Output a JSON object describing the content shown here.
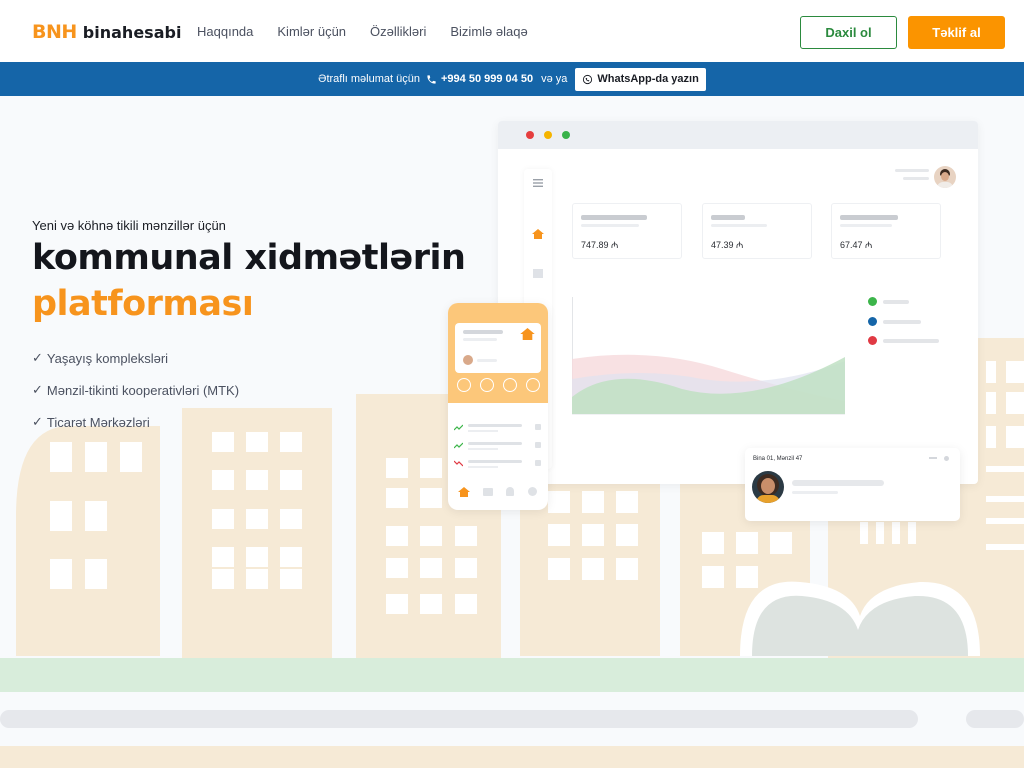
{
  "header": {
    "logo_mark": "BNH",
    "logo_text": "binahesabi",
    "nav": [
      "Haqqında",
      "Kimlər üçün",
      "Özəllikləri",
      "Bizimlə əlaqə"
    ],
    "login_label": "Daxil ol",
    "offer_label": "Təklif al"
  },
  "infobar": {
    "prefix": "Ətraflı məlumat üçün",
    "phone": "+994 50 999 04 50",
    "or": "və ya",
    "whatsapp": "WhatsApp-da yazın"
  },
  "hero": {
    "subtitle": "Yeni və köhnə tikili mənzillər üçün",
    "title_line1": "kommunal xidmətlərin",
    "title_line2": "platforması",
    "features": [
      "Yaşayış kompleksləri",
      "Mənzil-tikinti kooperativləri (MTK)",
      "Ticarət Mərkəzləri"
    ]
  },
  "dashboard": {
    "stats": [
      "747.89 ₼",
      "47.39 ₼",
      "67.47 ₼"
    ],
    "legend_colors": [
      "#3cb54a",
      "#1565a8",
      "#e03a44"
    ]
  },
  "profile": {
    "label": "Bina 01, Mənzil 47"
  },
  "colors": {
    "brand_orange": "#f7941d",
    "brand_blue": "#1565a8",
    "brand_green": "#2b8a3e"
  }
}
